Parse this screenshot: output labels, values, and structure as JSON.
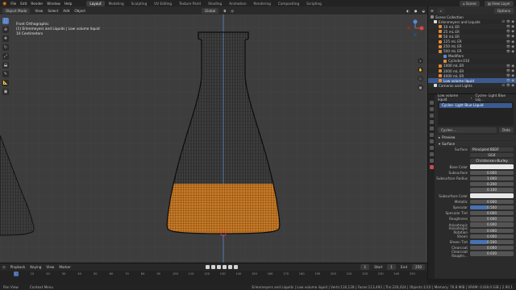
{
  "topbar": {
    "menus": [
      "File",
      "Edit",
      "Render",
      "Window",
      "Help"
    ],
    "tabs": [
      "Layout",
      "Modeling",
      "Sculpting",
      "UV Editing",
      "Texture Paint",
      "Shading",
      "Animation",
      "Rendering",
      "Compositing",
      "Scripting"
    ],
    "scene": "Scene",
    "view_layer": "View Layer"
  },
  "viewport_header": {
    "mode": "Object Mode",
    "menus": [
      "View",
      "Select",
      "Add",
      "Object"
    ],
    "orientation": "Global"
  },
  "viewport": {
    "info_lines": [
      "Front Orthographic",
      "(1) Erlenmeyers and Liquids | Low volume liquid",
      "10 Centimeters"
    ],
    "liquid_color": "#c87a26",
    "wire_color": "#101010"
  },
  "outliner": {
    "header": "Options",
    "rows": [
      {
        "label": "Scene Collection",
        "flags": ""
      },
      {
        "label": "Erlenmeyers and Liquids",
        "flags": "☑ 👁 ◉"
      },
      {
        "label": "10 mL ER",
        "flags": "👁 ◉"
      },
      {
        "label": "25 mL ER",
        "flags": "👁 ◉"
      },
      {
        "label": "50 mL ER",
        "flags": "👁 ◉"
      },
      {
        "label": "125 mL ER",
        "flags": "👁 ◉"
      },
      {
        "label": "250 mL ER",
        "flags": "👁 ◉"
      },
      {
        "label": "500 mL ER",
        "flags": "👁 ◉"
      },
      {
        "label": "Modifiers",
        "flags": ""
      },
      {
        "label": "Cylinder.010",
        "flags": ""
      },
      {
        "label": "1000 mL ER",
        "flags": "👁 ◉"
      },
      {
        "label": "2000 mL ER",
        "flags": "👁 ◉"
      },
      {
        "label": "4000 mL ER",
        "flags": "👁 ◉"
      },
      {
        "label": "Low volume liquid",
        "flags": "👁 ◉"
      },
      {
        "label": "Cameras and Lights",
        "flags": "☑ 👁 ◉"
      }
    ],
    "selected_index": 13
  },
  "properties": {
    "breadcrumb": [
      "Low volume liquid",
      "Cycles- Light Blue Liq..."
    ],
    "slot": "Cycles- Light Blue Liquid",
    "material_name": "Cycles-...",
    "data_label": "Data",
    "sections": [
      "Preview",
      "Surface"
    ],
    "surface": "Principled BSDF",
    "distribution": "GGX",
    "subsurface_method": "Christensen-Burley",
    "rows": [
      {
        "label": "Base Color",
        "value": "",
        "style": "white"
      },
      {
        "label": "Subsurface",
        "value": "0.000",
        "style": ""
      },
      {
        "label": "Subsurface Radius",
        "value": "1.000",
        "style": ""
      },
      {
        "label": "",
        "value": "0.200",
        "style": ""
      },
      {
        "label": "",
        "value": "0.100",
        "style": ""
      },
      {
        "label": "Subsurface Color",
        "value": "",
        "style": "white"
      },
      {
        "label": "Metallic",
        "value": "0.000",
        "style": ""
      },
      {
        "label": "Specular",
        "value": "0.500",
        "style": "blue"
      },
      {
        "label": "Specular Tint",
        "value": "0.000",
        "style": ""
      },
      {
        "label": "Roughness",
        "value": "0.000",
        "style": ""
      },
      {
        "label": "Anisotropic",
        "value": "0.000",
        "style": ""
      },
      {
        "label": "Anisotropic Rotation",
        "value": "0.000",
        "style": ""
      },
      {
        "label": "Sheen",
        "value": "0.000",
        "style": ""
      },
      {
        "label": "Sheen Tint",
        "value": "0.500",
        "style": "blue"
      },
      {
        "label": "Clearcoat",
        "value": "0.000",
        "style": ""
      },
      {
        "label": "Clearcoat Roughn...",
        "value": "0.030",
        "style": ""
      }
    ]
  },
  "timeline": {
    "menus": [
      "Playback",
      "Keying",
      "View",
      "Marker"
    ],
    "current_frame": "1",
    "start_label": "Start",
    "start": "1",
    "end_label": "End",
    "end": "250",
    "ticks": [
      "0",
      "10",
      "20",
      "30",
      "40",
      "50",
      "60",
      "70",
      "80",
      "90",
      "100",
      "110",
      "120",
      "130",
      "140",
      "150",
      "160",
      "170",
      "180",
      "190",
      "200",
      "210",
      "220",
      "230",
      "240",
      "250"
    ]
  },
  "status": {
    "left": [
      "Pan View",
      "Context Menu"
    ],
    "right": "Erlenmeyers and Liquids | Low volume liquid | Verts:116,128 | Faces:113,492 | Tris:226,024 | Objects:1/10 | Memory: 76.8 MiB | VRAM: 0.6/8.0 GiB | 2.90.1"
  }
}
